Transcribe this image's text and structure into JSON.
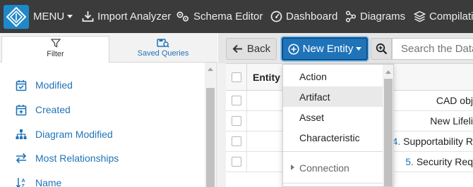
{
  "navbar": {
    "brand_icon": "diamond-logo-icon",
    "menu_label": "MENU",
    "items": [
      {
        "label": "Import Analyzer",
        "icon": "import-icon"
      },
      {
        "label": "Schema Editor",
        "icon": "gears-icon"
      },
      {
        "label": "Dashboard",
        "icon": "gauge-icon"
      },
      {
        "label": "Diagrams",
        "icon": "diagram-icon"
      },
      {
        "label": "Compilatio",
        "icon": "layers-icon"
      }
    ]
  },
  "left_panel": {
    "tabs": [
      {
        "label": "Filter",
        "icon": "funnel-icon",
        "active": true
      },
      {
        "label": "Saved Queries",
        "icon": "saved-query-icon",
        "active": false
      }
    ],
    "filters": [
      {
        "label": "Modified",
        "icon": "calendar-check-icon"
      },
      {
        "label": "Created",
        "icon": "calendar-plus-icon"
      },
      {
        "label": "Diagram Modified",
        "icon": "sitemap-icon"
      },
      {
        "label": "Most Relationships",
        "icon": "exchange-icon"
      },
      {
        "label": "Name",
        "icon": "sort-alpha-icon"
      }
    ]
  },
  "toolbar": {
    "back_label": "Back",
    "new_entity_label": "New Entity",
    "search_placeholder": "Search the Data"
  },
  "table": {
    "header_entity": "Entity",
    "rows": [
      {
        "num": "",
        "text": "CAD obj"
      },
      {
        "num": "",
        "text": "New Lifeli"
      },
      {
        "num": "4.",
        "text": " Supportability R"
      },
      {
        "num": "5.",
        "text": " Security Req"
      }
    ]
  },
  "dropdown": {
    "items": [
      {
        "label": "Action",
        "hover": false
      },
      {
        "label": "Artifact",
        "hover": true
      },
      {
        "label": "Asset",
        "hover": false
      },
      {
        "label": "Characteristic",
        "hover": false
      }
    ],
    "submenu_label": "Connection"
  },
  "colors": {
    "navbar_bg": "#3b3b3b",
    "brand_bg": "#1f88c9",
    "accent_blue": "#1f73b8",
    "hover_bg": "#e9e9e9"
  }
}
